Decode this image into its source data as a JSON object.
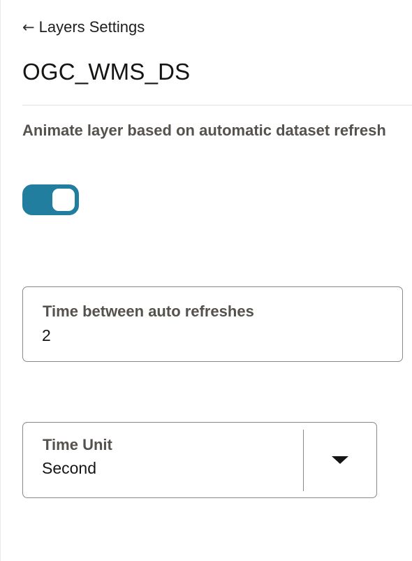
{
  "header": {
    "back_arrow": "←",
    "back_label": "Layers Settings",
    "title": "OGC_WMS_DS"
  },
  "animate": {
    "label": "Animate layer based on automatic dataset refresh",
    "enabled": true,
    "accent_color": "#227e9e"
  },
  "refresh_interval": {
    "label": "Time between auto refreshes",
    "value": "2"
  },
  "time_unit": {
    "label": "Time Unit",
    "value": "Second",
    "dropdown_icon": "caret-down-icon"
  }
}
